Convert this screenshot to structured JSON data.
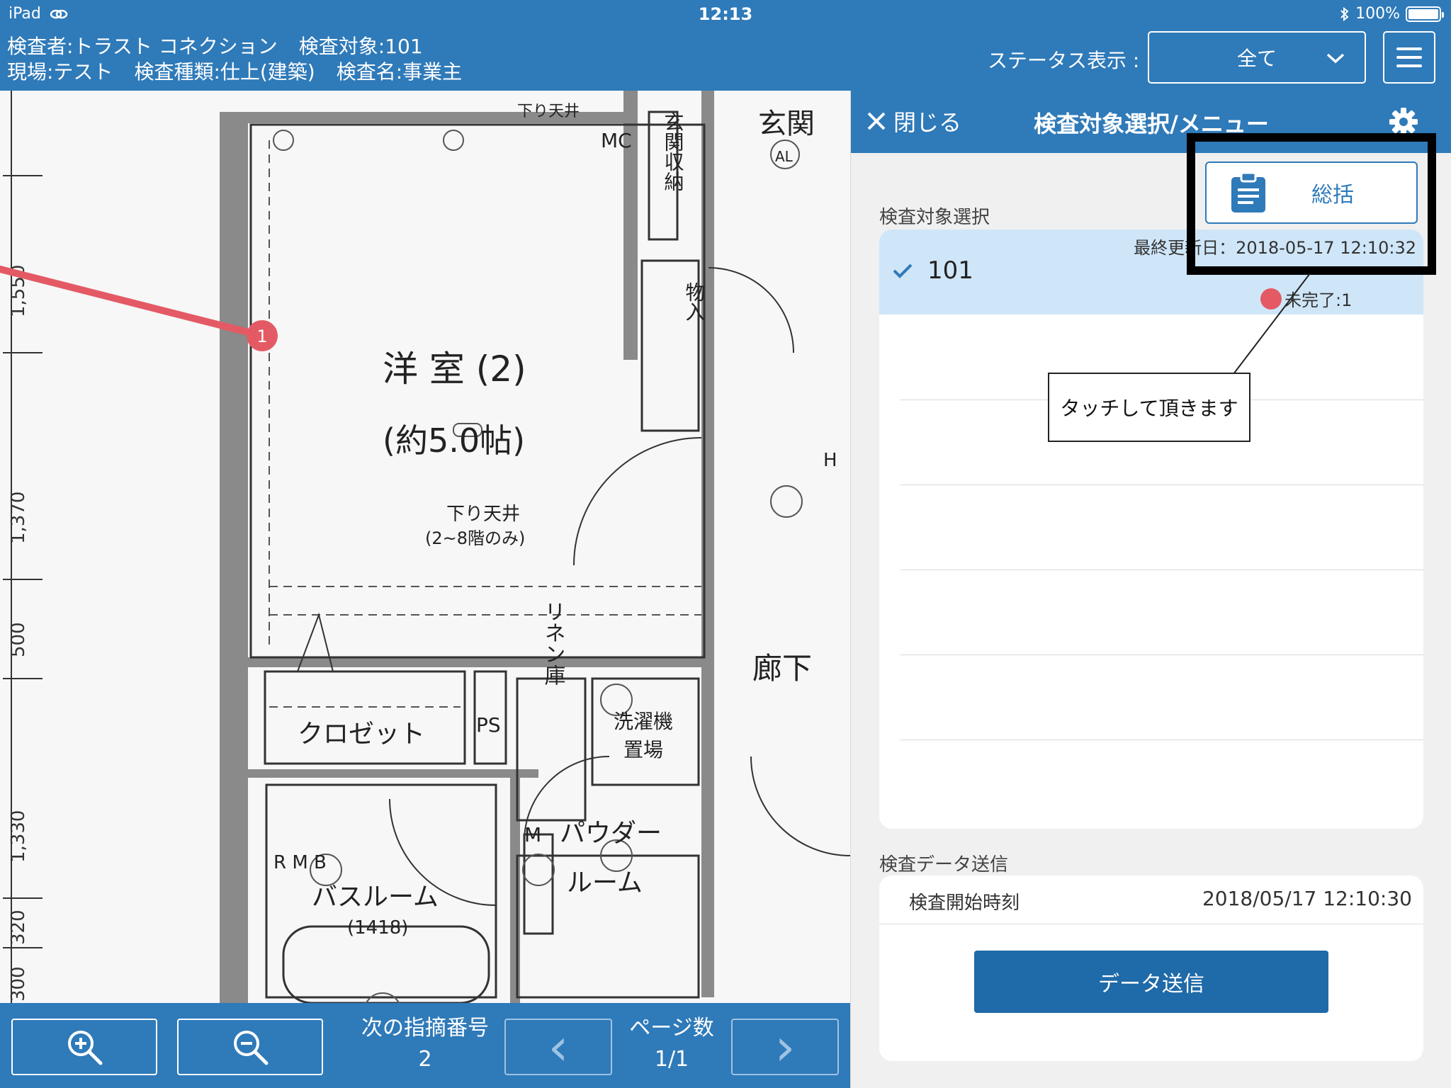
{
  "status_bar": {
    "device": "iPad",
    "time": "12:13",
    "battery": "100%"
  },
  "header": {
    "inspector": "検査者:トラスト コネクション",
    "target": "検査対象:101",
    "site": "現場:テスト",
    "type": "検査種類:仕上(建築)",
    "name": "検査名:事業主",
    "status_label": "ステータス表示 :",
    "status_value": "全て"
  },
  "floorplan": {
    "dims": [
      "1,550",
      "1,370",
      "500",
      "1,330",
      "300",
      "320"
    ],
    "rooms": {
      "western": "洋 室 (2)",
      "western_size": "(約5.0帖)",
      "closet": "クロゼット",
      "bathroom": "バスルーム",
      "bathroom_size": "(1418)",
      "powder": "パウダー",
      "powder2": "ルーム",
      "corridor": "廊下",
      "entrance": "玄関",
      "entrance_storage": "玄関収納",
      "linen": "リネン庫",
      "laundry": "洗濯機",
      "laundry2": "置場",
      "storage": "物入",
      "ps": "PS",
      "mc": "MC",
      "m": "M",
      "h": "H",
      "al": "AL",
      "ceiling_top": "下り天井",
      "ceiling_drop": "下り天井",
      "ceiling_note": "(2~8階のみ)",
      "rmb": "R M B"
    },
    "pin_number": "1"
  },
  "toolbar": {
    "next_label": "次の指摘番号",
    "next_value": "2",
    "page_label": "ページ数",
    "page_value": "1/1",
    "prev_arrow": "‹",
    "next_arrow": "›"
  },
  "panel": {
    "close": "閉じる",
    "title": "検査対象選択/メニュー",
    "target_section": "検査対象選択",
    "summary_button": "総括",
    "target_item": {
      "name": "101",
      "updated": "最終更新日：2018-05-17 12:10:32",
      "pending": "未完了:1"
    },
    "callout": "タッチして頂きます",
    "send_section": "検査データ送信",
    "start_label": "検査開始時刻",
    "start_time": "2018/05/17 12:10:30",
    "send_button": "データ送信"
  },
  "colors": {
    "accent": "#2f7ab9",
    "pin": "#e45a64",
    "selected_row": "#cfe6f8",
    "send_button": "#1f6aa8"
  }
}
